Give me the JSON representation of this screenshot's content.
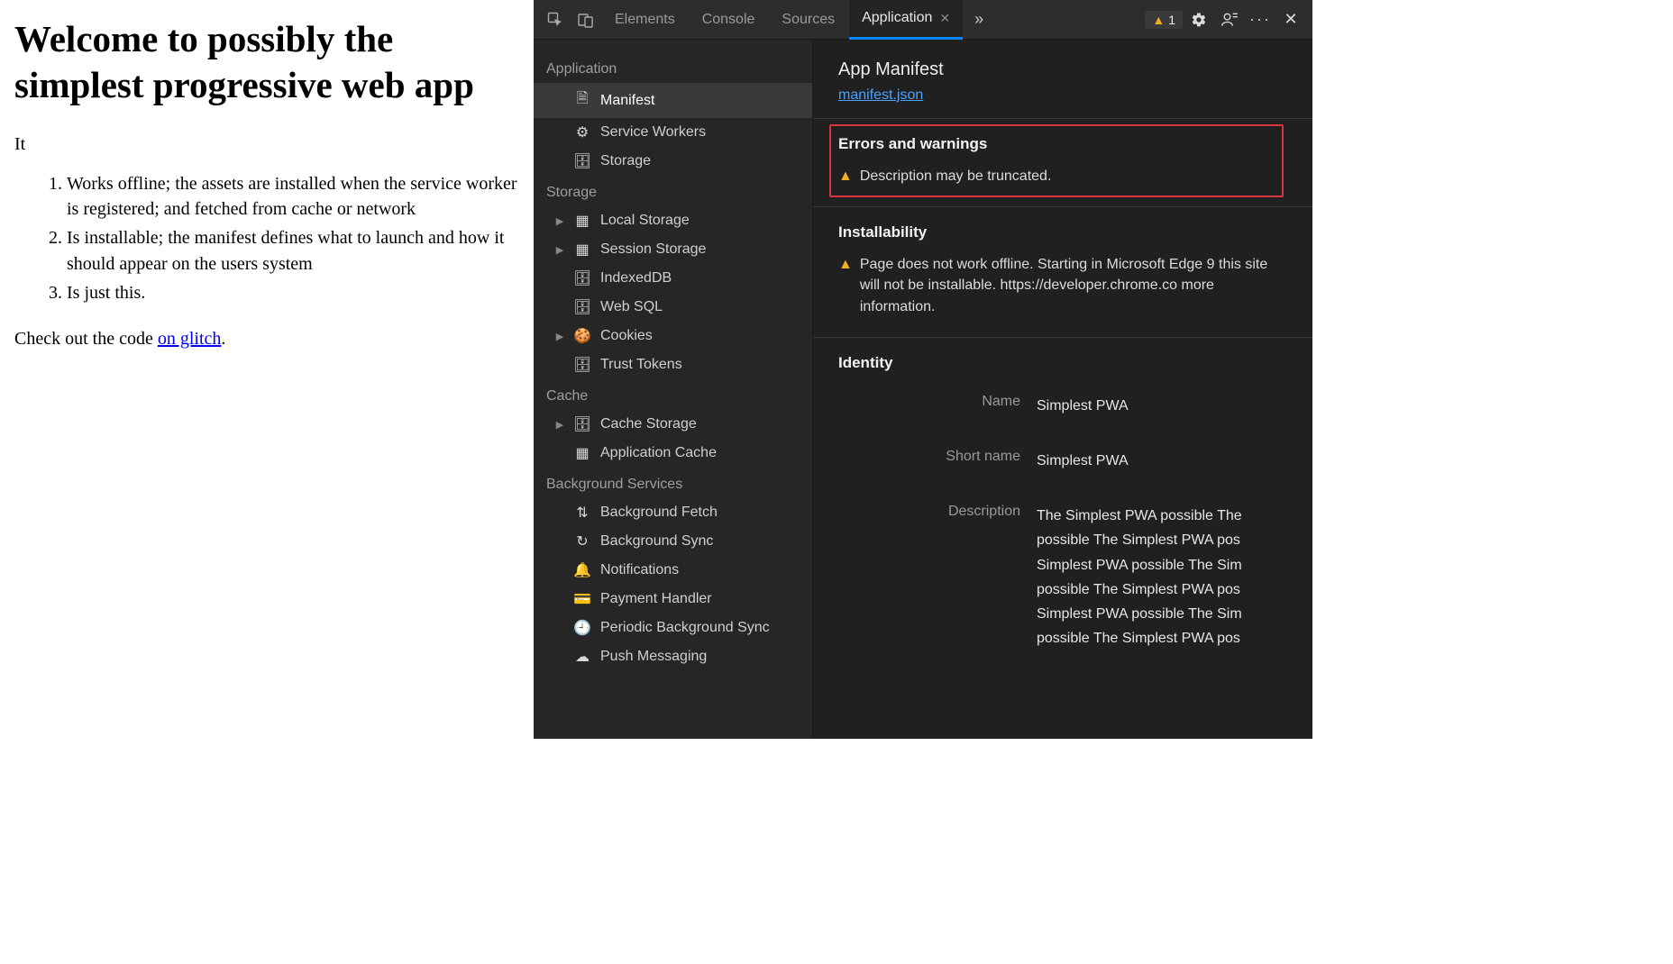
{
  "page": {
    "heading": "Welcome to possibly the simplest progressive web app",
    "intro": "It",
    "list": [
      "Works offline; the assets are installed when the service worker is registered; and fetched from cache or network",
      "Is installable; the manifest defines what to launch and how it should appear on the users system",
      "Is just this."
    ],
    "footer_pre": "Check out the code ",
    "footer_link": "on glitch",
    "footer_post": "."
  },
  "devtools": {
    "tabs": {
      "elements": "Elements",
      "console": "Console",
      "sources": "Sources",
      "application": "Application",
      "more": "»"
    },
    "issues_count": "1",
    "sidebar": {
      "s0_head": "Application",
      "s0_items": {
        "manifest": "Manifest",
        "service_workers": "Service Workers",
        "storage": "Storage"
      },
      "s1_head": "Storage",
      "s1_items": {
        "local": "Local Storage",
        "session": "Session Storage",
        "indexeddb": "IndexedDB",
        "websql": "Web SQL",
        "cookies": "Cookies",
        "trusttokens": "Trust Tokens"
      },
      "s2_head": "Cache",
      "s2_items": {
        "cachestorage": "Cache Storage",
        "appcache": "Application Cache"
      },
      "s3_head": "Background Services",
      "s3_items": {
        "bgfetch": "Background Fetch",
        "bgsync": "Background Sync",
        "notif": "Notifications",
        "payment": "Payment Handler",
        "periodic": "Periodic Background Sync",
        "push": "Push Messaging"
      }
    },
    "main": {
      "title": "App Manifest",
      "manifest_link": "manifest.json",
      "errors_heading": "Errors and warnings",
      "errors_msg": "Description may be truncated.",
      "install_heading": "Installability",
      "install_msg": "Page does not work offline. Starting in Microsoft Edge 9 this site will not be installable. https://developer.chrome.co more information.",
      "identity_heading": "Identity",
      "identity": {
        "name_k": "Name",
        "name_v": "Simplest PWA",
        "short_k": "Short name",
        "short_v": "Simplest PWA",
        "desc_k": "Description",
        "desc_v": "The Simplest PWA possible The possible The Simplest PWA pos Simplest PWA possible The Sim possible The Simplest PWA pos Simplest PWA possible The Sim possible The Simplest PWA pos"
      }
    }
  }
}
